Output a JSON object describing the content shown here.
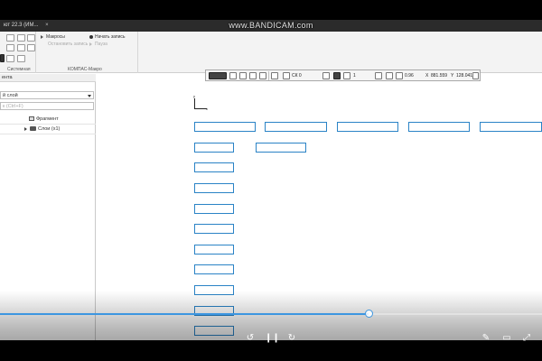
{
  "window": {
    "title": "ют 22.3 (ИМ...",
    "close_glyph": "×"
  },
  "watermark": {
    "text": "www.BANDICAM.com"
  },
  "ribbon": {
    "macro_group": {
      "items": [
        {
          "label": "Макросы",
          "enabled": true
        },
        {
          "label": "Остановить запись",
          "enabled": false
        }
      ],
      "record": {
        "label": "Начать запись",
        "enabled": true
      },
      "pause": {
        "label": "Пауза",
        "enabled": false
      }
    },
    "captions": {
      "system": "Системная",
      "kompas_macro": "КОМПАС-Макро"
    }
  },
  "canvas_toolbar": {
    "coordinate_system": "СК 0",
    "layer_number": "1",
    "zoom": "0.96",
    "coord_x_label": "X",
    "coord_x": "881.559",
    "coord_y_label": "Y",
    "coord_y": "128.041"
  },
  "left_panel": {
    "tab_label": "ента",
    "layer_select": "й слой",
    "search_placeholder": "к (Ctrl+F)",
    "tree": [
      {
        "label": "Фрагмент",
        "icon": "fragment-icon",
        "level": 0
      },
      {
        "label": "Слои (x1)",
        "icon": "folder-icon",
        "level": 1
      }
    ]
  },
  "axis": {
    "x_label": "x",
    "y_label": "y"
  },
  "player": {
    "progress": 0.68,
    "controls": [
      "rewind-icon",
      "pause-icon",
      "forward-icon",
      "pen-icon",
      "screen-icon",
      "fullscreen-icon"
    ]
  },
  "colors": {
    "box_stroke": "#2a83c6",
    "seek_played": "#3d96e0",
    "title_bar": "#2b2b2b"
  }
}
